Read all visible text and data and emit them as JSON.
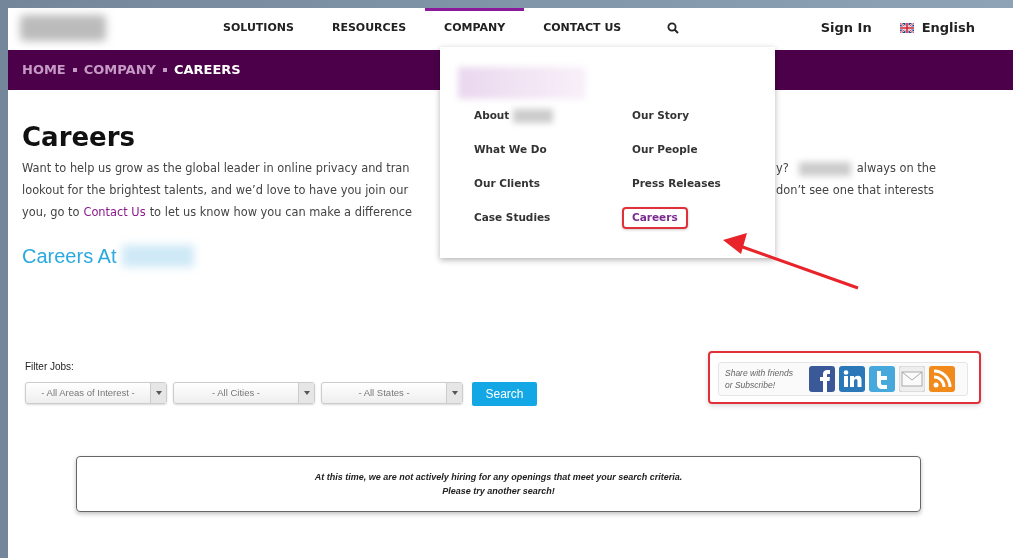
{
  "header": {
    "nav": [
      {
        "label": "SOLUTIONS",
        "selected": false
      },
      {
        "label": "RESOURCES",
        "selected": false
      },
      {
        "label": "COMPANY",
        "selected": true
      },
      {
        "label": "CONTACT US",
        "selected": false
      }
    ],
    "sign_in": "Sign In",
    "language": "English"
  },
  "breadcrumb": [
    {
      "label": "HOME",
      "current": false
    },
    {
      "label": "COMPANY",
      "current": false
    },
    {
      "label": "CAREERS",
      "current": true
    }
  ],
  "dropdown": {
    "columns": [
      [
        {
          "label": "About",
          "blurred_suffix": true,
          "selected": false
        },
        {
          "label": "What We Do",
          "blurred_suffix": false,
          "selected": false
        },
        {
          "label": "Our Clients",
          "blurred_suffix": false,
          "selected": false
        },
        {
          "label": "Case Studies",
          "blurred_suffix": false,
          "selected": false
        }
      ],
      [
        {
          "label": "Our Story",
          "blurred_suffix": false,
          "selected": false
        },
        {
          "label": "Our People",
          "blurred_suffix": false,
          "selected": false
        },
        {
          "label": "Press Releases",
          "blurred_suffix": false,
          "selected": false
        },
        {
          "label": "Careers",
          "blurred_suffix": false,
          "selected": true
        }
      ]
    ]
  },
  "page": {
    "title": "Careers",
    "intro": [
      {
        "left": [
          {
            "kind": "text",
            "text": "Want to help us grow as the global leader in online privacy and tran"
          }
        ],
        "right": [
          {
            "kind": "text",
            "text": "y?"
          },
          {
            "kind": "blurred"
          },
          {
            "kind": "text",
            "text": "always on the"
          }
        ]
      },
      {
        "left": [
          {
            "kind": "text",
            "text": "lookout for the brightest talents, and we’d love to have you join our"
          }
        ],
        "right": [
          {
            "kind": "text",
            "text": "don’t see one that interests"
          }
        ]
      },
      {
        "left": [
          {
            "kind": "text",
            "text": "you, go to"
          },
          {
            "kind": "link",
            "text": "Contact Us"
          },
          {
            "kind": "text",
            "text": "to let us know how you can make a difference"
          }
        ]
      }
    ],
    "section_heading": "Careers At"
  },
  "filter": {
    "label": "Filter Jobs:",
    "selects": [
      {
        "value": "- All Areas of Interest -"
      },
      {
        "value": "- All Cities -"
      },
      {
        "value": "- All States -"
      }
    ],
    "button": "Search"
  },
  "share": {
    "text": "Share with friends or Subscribe!",
    "icons": [
      {
        "kind": "facebook"
      },
      {
        "kind": "linkedin"
      },
      {
        "kind": "twitter"
      },
      {
        "kind": "email"
      },
      {
        "kind": "rss"
      }
    ]
  },
  "notice": {
    "lines": [
      "At this time, we are not actively hiring for any openings that meet your search criteria.",
      "Please try another search!"
    ]
  }
}
